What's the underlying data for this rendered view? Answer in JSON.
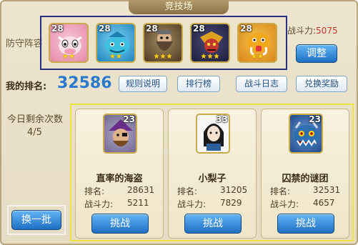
{
  "window": {
    "title": "竞技场"
  },
  "defense": {
    "label": "防守阵容",
    "power_label": "战斗力:",
    "power_value": "5075",
    "adjust_label": "调整",
    "heroes": [
      {
        "level": "28",
        "stars": "★★",
        "icon": "cow-hero-icon",
        "bg": "#e8a0b8"
      },
      {
        "level": "28",
        "stars": "★★",
        "icon": "blue-fish-hero-icon",
        "bg": "#3aa6d8"
      },
      {
        "level": "28",
        "stars": "★★★",
        "icon": "dwarf-hero-icon",
        "bg": "#6b5a3a"
      },
      {
        "level": "28",
        "stars": "★★★",
        "icon": "demon-hero-icon",
        "bg": "#8a3a3a"
      },
      {
        "level": "28",
        "stars": "★★",
        "icon": "mammoth-hero-icon",
        "bg": "#e6a21a"
      }
    ]
  },
  "rank": {
    "label": "我的排名:",
    "value": "32586",
    "buttons": [
      "规则说明",
      "排行榜",
      "战斗日志",
      "兑换奖励"
    ]
  },
  "remaining": {
    "label": "今日剩余次数",
    "value": "4/5"
  },
  "refresh_label": "换一批",
  "opponents": [
    {
      "name": "直率的海盗",
      "level": "23",
      "rank_label": "排名:",
      "rank": "28631",
      "power_label": "战斗力:",
      "power": "5211",
      "challenge": "挑战",
      "icon": "pirate-portrait-icon",
      "bg": "#8f8aa6"
    },
    {
      "name": "小梨子",
      "level": "33",
      "rank_label": "排名:",
      "rank": "31205",
      "power_label": "战斗力:",
      "power": "7829",
      "challenge": "挑战",
      "icon": "girl-portrait-icon",
      "bg": "#f4f4f4"
    },
    {
      "name": "囚禁的谜团",
      "level": "23",
      "rank_label": "排名:",
      "rank": "32531",
      "power_label": "战斗力:",
      "power": "4657",
      "challenge": "挑战",
      "icon": "monster-portrait-icon",
      "bg": "#3d6fb0"
    }
  ]
}
